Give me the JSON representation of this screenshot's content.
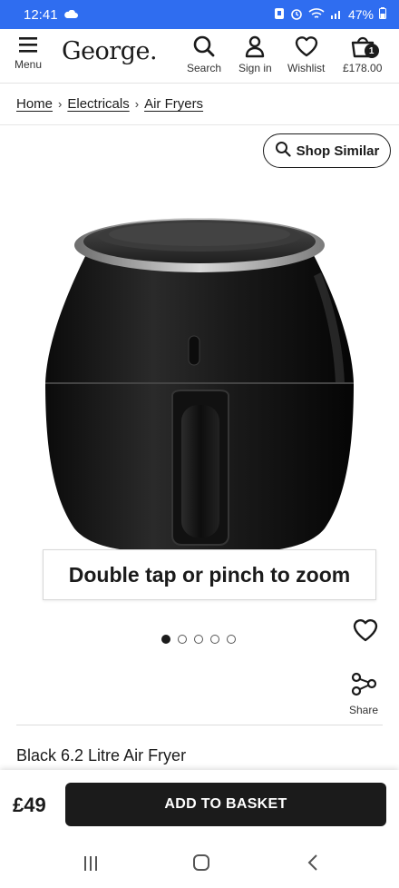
{
  "status_bar": {
    "time": "12:41",
    "battery": "47%"
  },
  "header": {
    "menu_label": "Menu",
    "logo": "George.",
    "search_label": "Search",
    "signin_label": "Sign in",
    "wishlist_label": "Wishlist",
    "basket_total": "£178.00",
    "basket_count": "1"
  },
  "breadcrumb": {
    "items": [
      "Home",
      "Electricals",
      "Air Fryers"
    ]
  },
  "shop_similar_label": "Shop Similar",
  "gallery": {
    "zoom_hint": "Double tap or pinch to zoom",
    "total_images": 5,
    "active_index": 0
  },
  "share_label": "Share",
  "product": {
    "title": "Black 6.2 Litre Air Fryer",
    "price": "£49"
  },
  "add_to_basket_label": "ADD TO BASKET",
  "colors": {
    "status_bar": "#2f6df0",
    "primary": "#1b1b1b"
  }
}
